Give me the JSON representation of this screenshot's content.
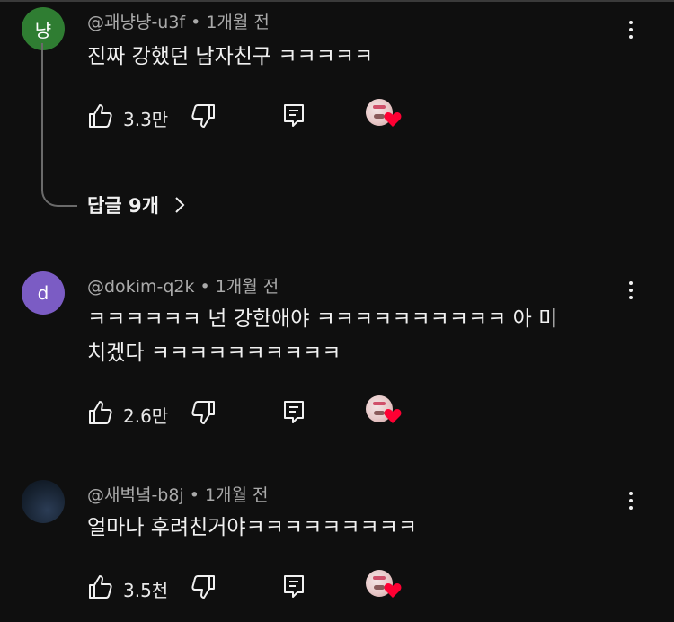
{
  "comments": [
    {
      "avatar_text": "냥",
      "avatar_color": "#2f7d32",
      "handle": "@괘냥냥-u3f",
      "time": "1개월 전",
      "text": "진짜 강했던 남자친구 ㅋㅋㅋㅋㅋ",
      "likes": "3.3만",
      "replies_label": "답글 9개"
    },
    {
      "avatar_text": "d",
      "avatar_color": "#7b5cc4",
      "handle": "@dokim-q2k",
      "time": "1개월 전",
      "text_line1": "ㅋㅋㅋㅋㅋㅋ 넌 강한애야 ㅋㅋㅋㅋㅋㅋㅋㅋㅋㅋ 아 미",
      "text_line2": "치겠다 ㅋㅋㅋㅋㅋㅋㅋㅋㅋㅋ",
      "likes": "2.6만"
    },
    {
      "avatar_text": "",
      "avatar_color": "#1c2a3d",
      "handle": "@새벽녘-b8j",
      "time": "1개월 전",
      "text": "얼마나 후려친거야ㅋㅋㅋㅋㅋㅋㅋㅋㅋ",
      "likes": "3.5천"
    }
  ],
  "separator": "•",
  "icons": {
    "like": "thumbs-up-icon",
    "dislike": "thumbs-down-icon",
    "reply": "reply-comment-icon",
    "more": "more-vertical-icon",
    "chevron": "chevron-right-icon",
    "creator_heart": "creator-heart-icon"
  },
  "colors": {
    "background": "#0f0f0f",
    "text": "#f1f1f1",
    "meta": "#aaaaaa",
    "heart": "#ff0033"
  }
}
